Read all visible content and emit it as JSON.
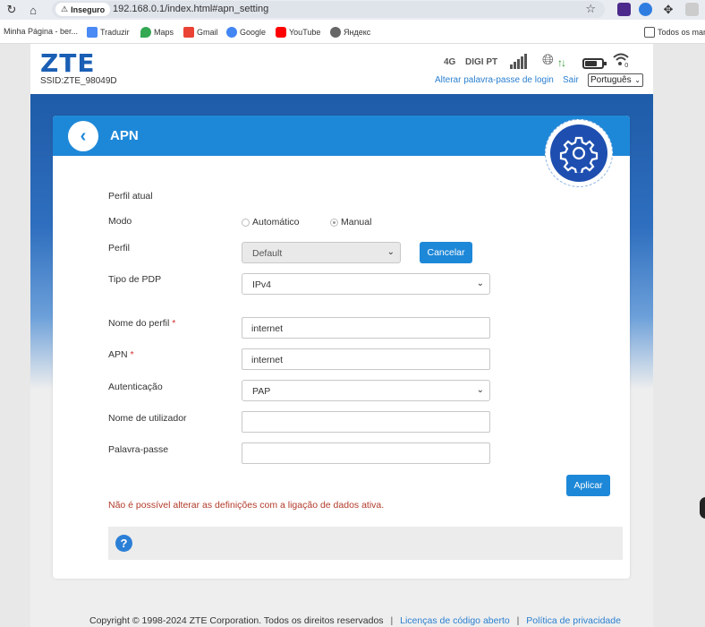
{
  "browser": {
    "security_label": "Inseguro",
    "url": "192.168.0.1/index.html#apn_setting",
    "bookmarks": [
      "Minha Página - ber...",
      "Traduzir",
      "Maps",
      "Gmail",
      "Google",
      "YouTube",
      "Яндекс"
    ],
    "all_bookmarks": "Todos os mar"
  },
  "header": {
    "logo": "ZTE",
    "ssid": "SSID:ZTE_98049D",
    "network_type": "4G",
    "operator": "DIGI PT",
    "change_password_link": "Alterar palavra-passe de login",
    "exit_link": "Sair",
    "language": "Português"
  },
  "card": {
    "title": "APN",
    "current_profile_label": "Perfil atual",
    "mode_label": "Modo",
    "mode_options": [
      "Automático",
      "Manual"
    ],
    "mode_selected": "Manual",
    "profile_label": "Perfil",
    "profile_value": "Default",
    "cancel_button": "Cancelar",
    "pdp_label": "Tipo de PDP",
    "pdp_value": "IPv4",
    "profile_name_label": "Nome do perfil",
    "profile_name_value": "internet",
    "apn_label": "APN",
    "apn_value": "internet",
    "auth_label": "Autenticação",
    "auth_value": "PAP",
    "username_label": "Nome de utilizador",
    "username_value": "",
    "password_label": "Palavra-passe",
    "password_value": "",
    "apply_button": "Aplicar",
    "warning": "Não é possível alterar as definições com a ligação de dados ativa.",
    "required_mark": "*"
  },
  "footer": {
    "copyright": "Copyright © 1998-2024 ZTE Corporation. Todos os direitos reservados",
    "separator": "|",
    "open_source_link": "Licenças de código aberto",
    "privacy_link": "Política de privacidade"
  },
  "colors": {
    "accent": "#1e88d8",
    "header_band": "#1e5ba8",
    "warning": "#b23a2a",
    "logo": "#1a5fb4"
  }
}
